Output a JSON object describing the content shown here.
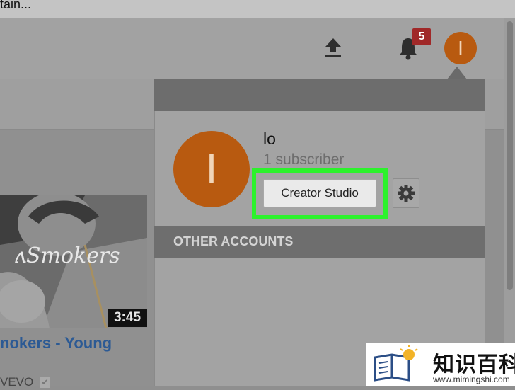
{
  "browser": {
    "title_fragment": "tain..."
  },
  "header": {
    "upload_icon": "upload-icon",
    "notifications": {
      "icon": "bell-icon",
      "count": "5"
    },
    "avatar_initial": "I"
  },
  "video": {
    "duration": "3:45",
    "title": "nokers - Young",
    "channel": "VEVO"
  },
  "account_menu": {
    "avatar_initial": "I",
    "name": "lo",
    "subscribers": "1 subscriber",
    "creator_studio_label": "Creator Studio",
    "settings_icon": "gear-icon",
    "other_accounts_label": "OTHER ACCOUNTS"
  },
  "watermark": {
    "text": "知识百科",
    "url": "www.mimingshi.com"
  },
  "colors": {
    "avatar": "#b85a10",
    "highlight": "#2cf22c",
    "badge": "#a02828",
    "link": "#2c5a94"
  }
}
